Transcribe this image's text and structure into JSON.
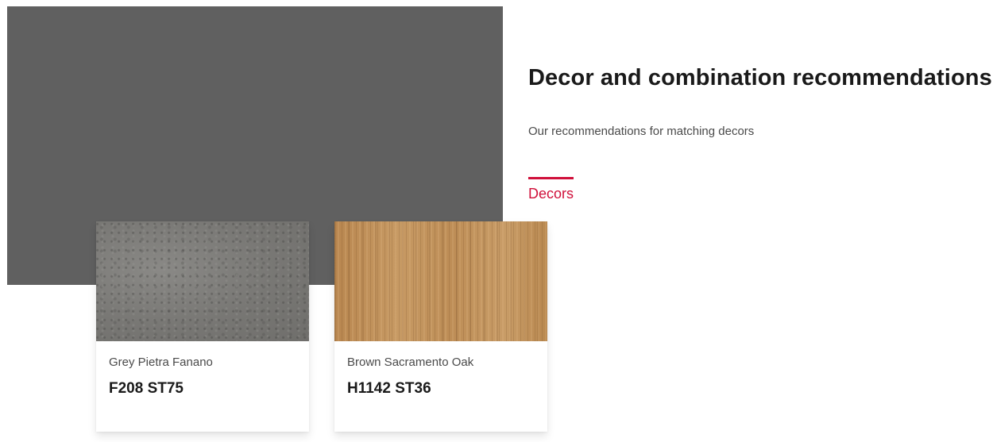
{
  "section": {
    "title": "Decor and combination recommendations",
    "subtitle": "Our recommendations for matching decors"
  },
  "tabs": [
    {
      "label": "Decors",
      "active": true
    }
  ],
  "decors": [
    {
      "name": "Grey Pietra Fanano",
      "code": "F208 ST75",
      "swatch": "grey-stone-texture"
    },
    {
      "name": "Brown Sacramento Oak",
      "code": "H1142 ST36",
      "swatch": "light-oak-wood-texture"
    }
  ],
  "colors": {
    "accent": "#d0103a",
    "hero_placeholder": "#606060",
    "text_primary": "#1a1a1a",
    "text_secondary": "#4a4a4a"
  }
}
